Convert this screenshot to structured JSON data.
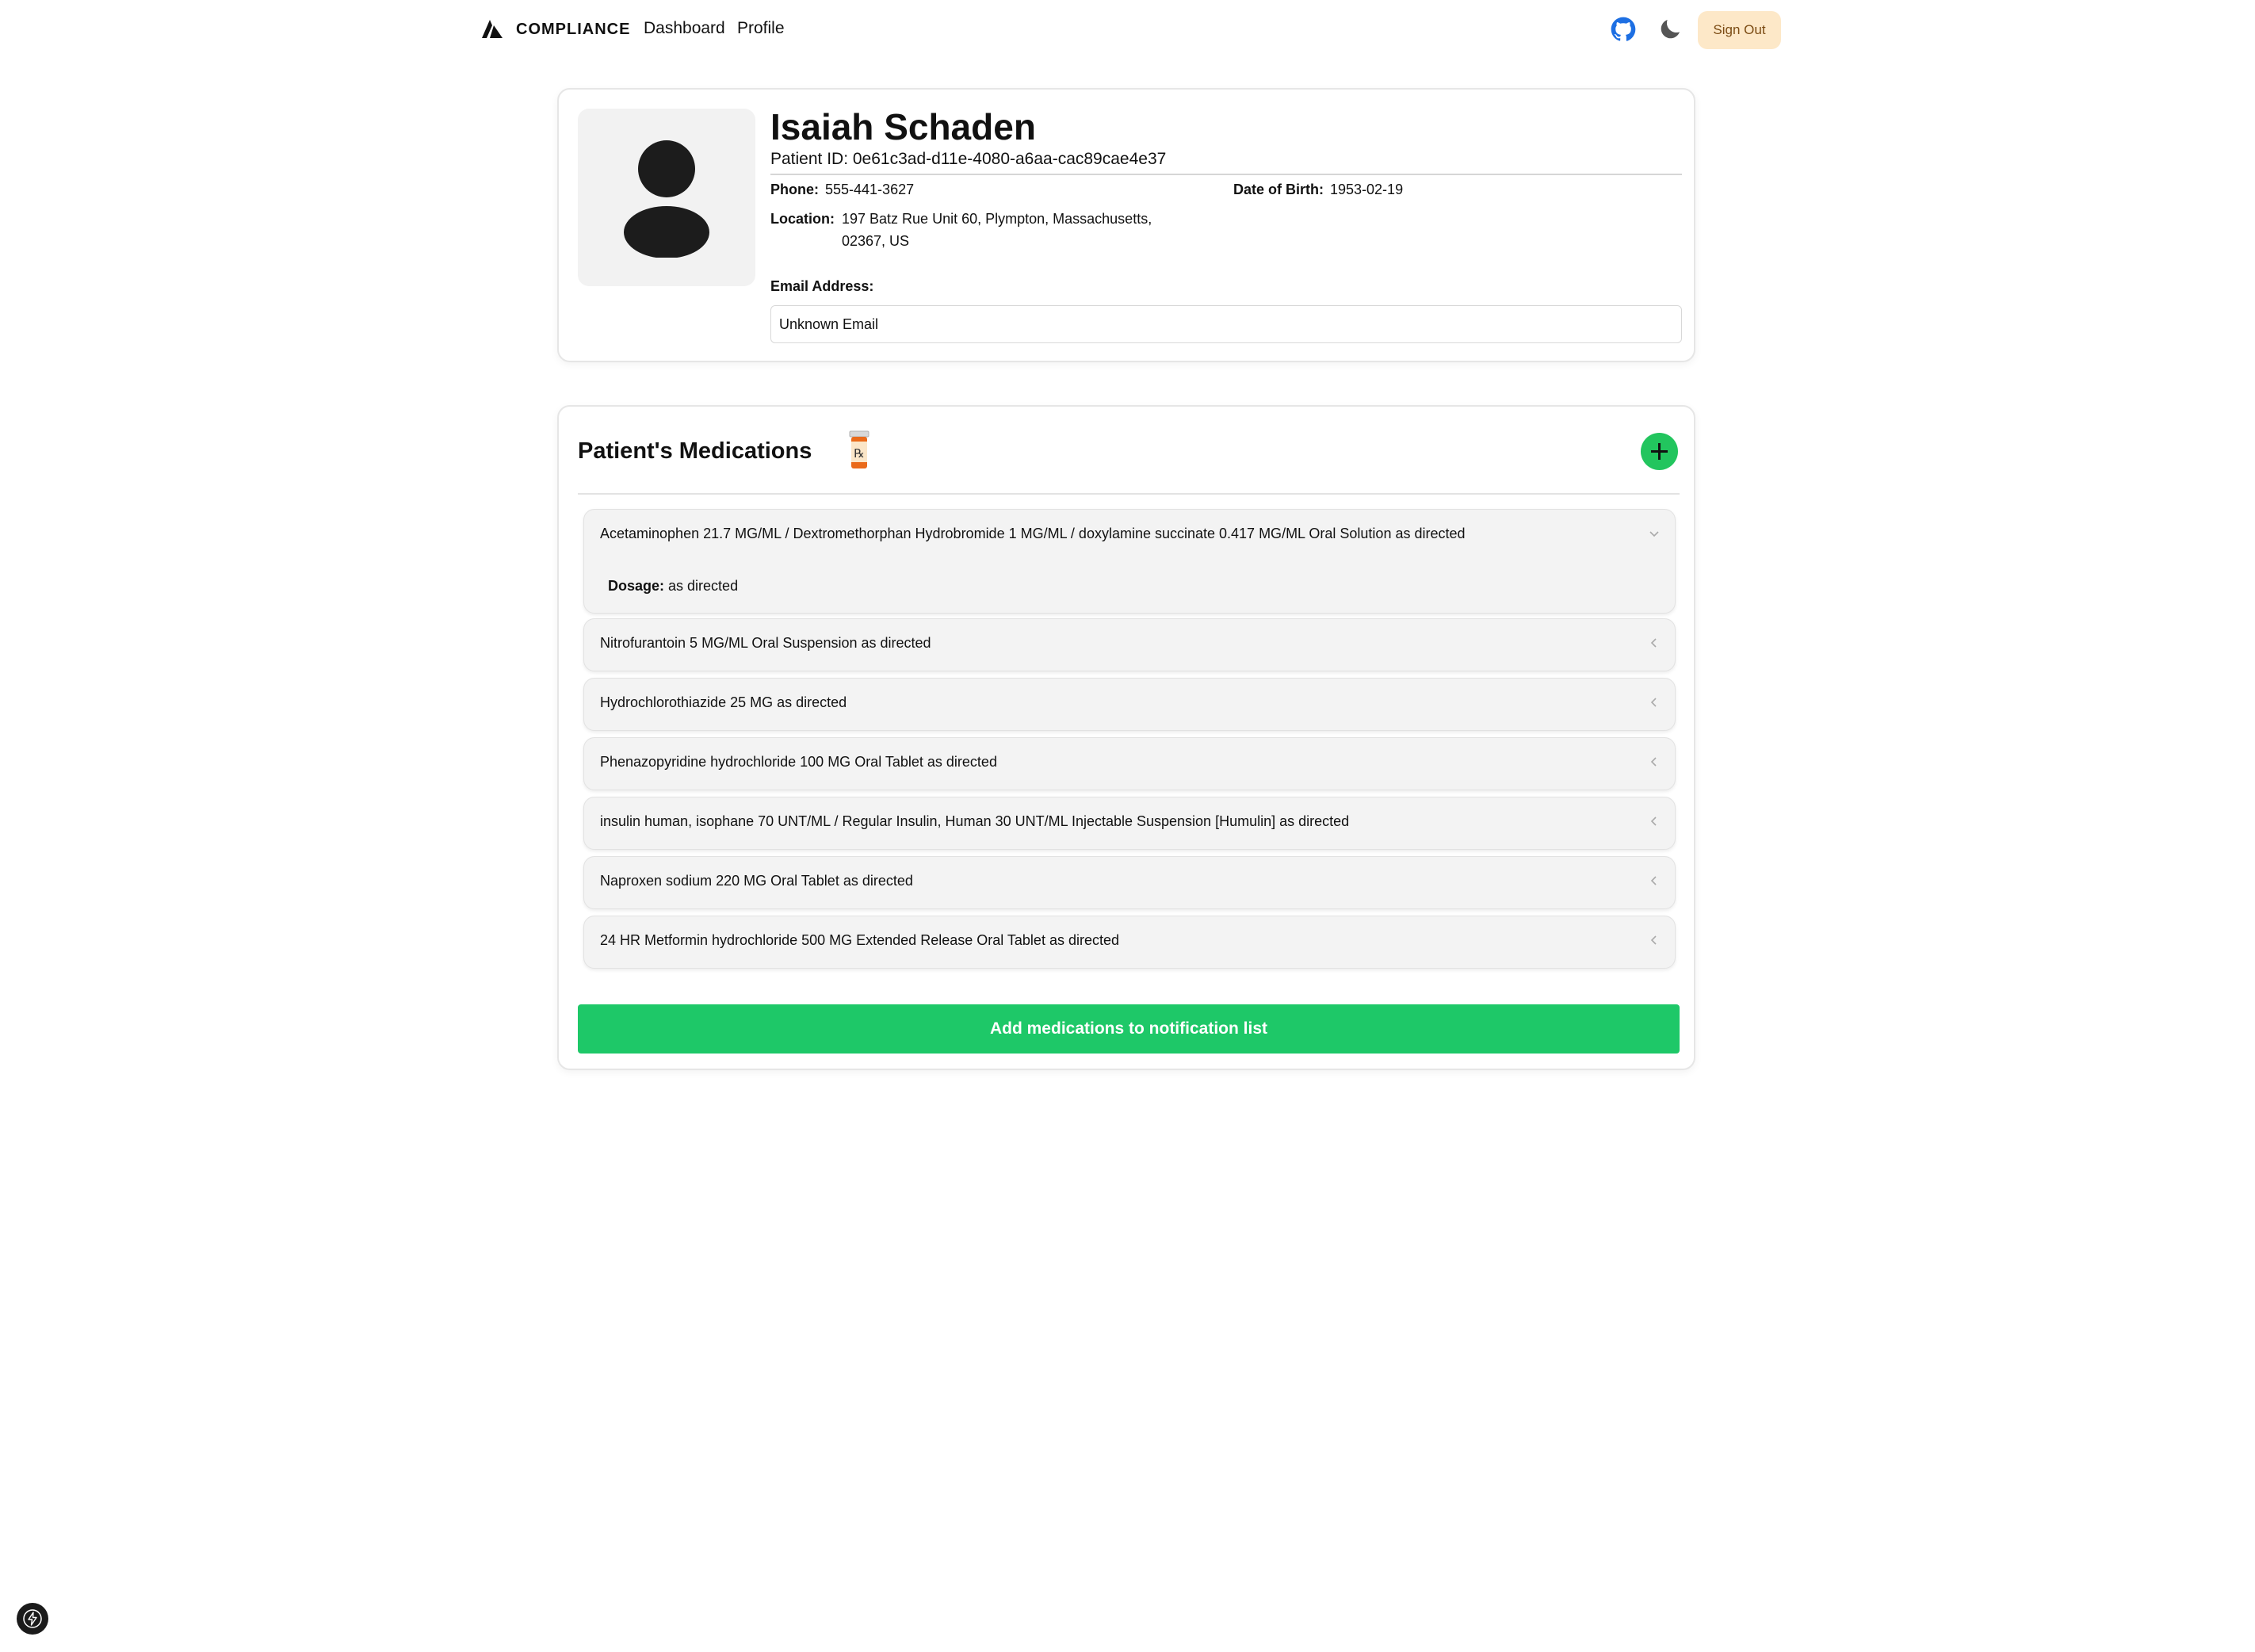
{
  "nav": {
    "brand": "COMPLIANCE",
    "links": [
      "Dashboard",
      "Profile"
    ],
    "sign_out": "Sign Out",
    "icons": [
      "github-icon",
      "moon-icon"
    ]
  },
  "patient": {
    "name": "Isaiah Schaden",
    "patient_id": "Patient ID: 0e61c3ad-d11e-4080-a6aa-cac89cae4e37",
    "phone_label": "Phone:",
    "phone": "555-441-3627",
    "dob_label": "Date of Birth:",
    "dob": "1953-02-19",
    "location_label": "Location:",
    "location": "197 Batz Rue Unit 60, Plympton, Massachusetts, 02367, US",
    "email_label": "Email Address:",
    "email_value": "Unknown Email"
  },
  "meds": {
    "title": "Patient's Medications",
    "dosage_label": "Dosage:",
    "items": [
      {
        "name": "Acetaminophen 21.7 MG/ML / Dextromethorphan Hydrobromide 1 MG/ML / doxylamine succinate 0.417 MG/ML Oral Solution as directed",
        "dosage": "as directed",
        "expanded": true
      },
      {
        "name": "Nitrofurantoin 5 MG/ML Oral Suspension as directed",
        "expanded": false
      },
      {
        "name": "Hydrochlorothiazide 25 MG as directed",
        "expanded": false
      },
      {
        "name": "Phenazopyridine hydrochloride 100 MG Oral Tablet as directed",
        "expanded": false
      },
      {
        "name": "insulin human, isophane 70 UNT/ML / Regular Insulin, Human 30 UNT/ML Injectable Suspension [Humulin] as directed",
        "expanded": false
      },
      {
        "name": "Naproxen sodium 220 MG Oral Tablet as directed",
        "expanded": false
      },
      {
        "name": "24 HR Metformin hydrochloride 500 MG Extended Release Oral Tablet as directed",
        "expanded": false
      }
    ],
    "notify_button": "Add medications to notification list"
  },
  "colors": {
    "accent_green": "#22c55e",
    "button_green": "#1ec868",
    "sign_out_bg": "#fde8c8",
    "github_blue": "#1d6fe3"
  }
}
